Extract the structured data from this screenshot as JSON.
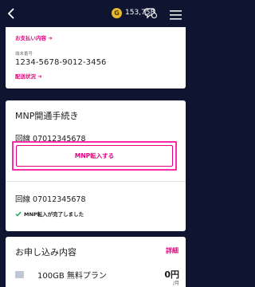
{
  "header": {
    "coin_symbol": "G",
    "points": "153,758"
  },
  "card1": {
    "payment_link": "お支払い内容 ➔",
    "device_label": "端末番号",
    "device_number": "1234-5678-9012-3456",
    "shipping_link": "配送状況 ➔"
  },
  "mnp": {
    "title": "MNP開通手続き",
    "line1": "回線 07012345678",
    "button_label": "MNP転入する",
    "line2": "回線 07012345678",
    "done_text": "MNP転入が完了しました"
  },
  "application": {
    "title": "お申し込み内容",
    "detail_link": "詳細",
    "plan_name": "100GB 無料プラン",
    "price": "0円",
    "price_unit": "/月"
  }
}
